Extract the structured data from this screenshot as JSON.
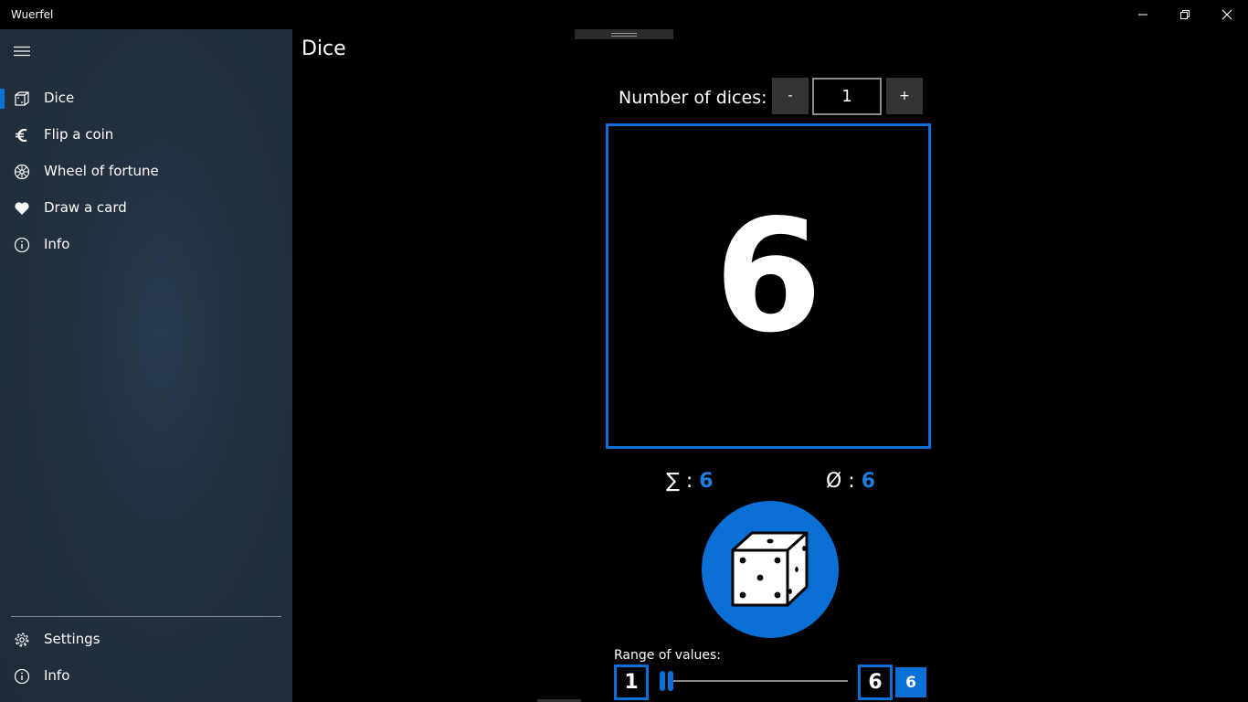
{
  "window": {
    "title": "Wuerfel"
  },
  "sidebar": {
    "items": [
      {
        "label": "Dice",
        "icon": "dice-icon",
        "active": true
      },
      {
        "label": "Flip a coin",
        "icon": "euro-icon"
      },
      {
        "label": "Wheel of fortune",
        "icon": "wheel-icon"
      },
      {
        "label": "Draw a card",
        "icon": "heart-icon"
      },
      {
        "label": "Info",
        "icon": "info-icon"
      }
    ],
    "footer": [
      {
        "label": "Settings",
        "icon": "gear-icon"
      },
      {
        "label": "Info",
        "icon": "info-icon"
      }
    ]
  },
  "page": {
    "title": "Dice",
    "number_label": "Number of dices:",
    "minus_label": "-",
    "plus_label": "+",
    "number_value": "1",
    "result": "6",
    "sum_symbol": "∑ :",
    "sum_value": "6",
    "avg_symbol": "Ø :",
    "avg_value": "6",
    "range_label": "Range of values:",
    "range_min": "1",
    "range_max": "6",
    "range_badge": "6"
  },
  "colors": {
    "accent": "#0a70d6",
    "background": "#000000",
    "sidebar": "#22303f"
  }
}
